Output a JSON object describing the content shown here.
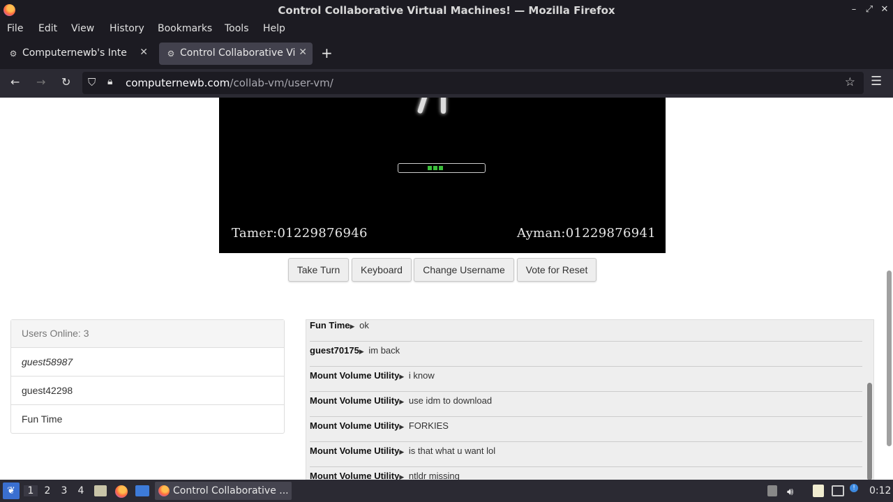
{
  "window": {
    "title": "Control Collaborative Virtual Machines! — Mozilla Firefox"
  },
  "menu": [
    "File",
    "Edit",
    "View",
    "History",
    "Bookmarks",
    "Tools",
    "Help"
  ],
  "tabs": [
    {
      "label": "Computernewb's Internet"
    },
    {
      "label": "Control Collaborative Virtual"
    }
  ],
  "url": {
    "domain": "computernewb.com",
    "path": "/collab-vm/user-vm/"
  },
  "vm": {
    "caption_left": "Tamer:01229876946",
    "caption_right": "Ayman:01229876941"
  },
  "buttons": {
    "take_turn": "Take Turn",
    "keyboard": "Keyboard",
    "change_username": "Change Username",
    "vote_reset": "Vote for Reset"
  },
  "users": {
    "header": "Users Online: 3",
    "list": [
      "guest58987",
      "guest42298",
      "Fun Time"
    ]
  },
  "chat": [
    {
      "user": "Fun Time",
      "text": "ok"
    },
    {
      "user": "guest70175",
      "text": "im back"
    },
    {
      "user": "Mount Volume Utility",
      "text": "i know"
    },
    {
      "user": "Mount Volume Utility",
      "text": "use idm to download"
    },
    {
      "user": "Mount Volume Utility",
      "text": "FORKIES"
    },
    {
      "user": "Mount Volume Utility",
      "text": "is that what u want lol"
    },
    {
      "user": "Mount Volume Utility",
      "text": "ntldr missing"
    }
  ],
  "taskbar": {
    "workspaces": [
      "1",
      "2",
      "3",
      "4"
    ],
    "window_label": "Control Collaborative ...",
    "clock": "0:12"
  }
}
